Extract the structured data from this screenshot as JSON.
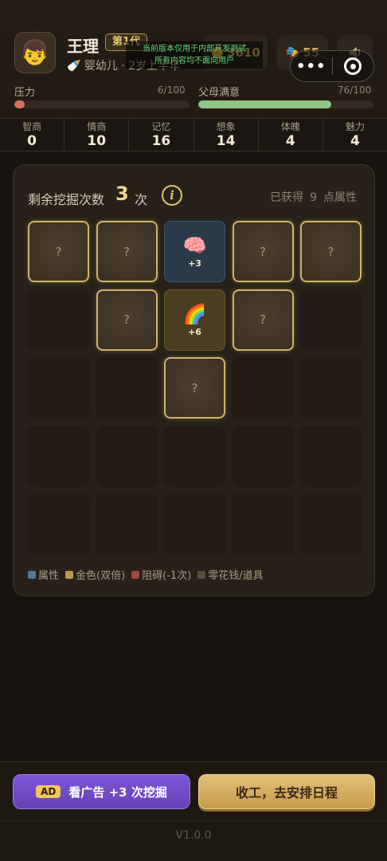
{
  "player": {
    "avatar_icon": "👦",
    "name": "王理",
    "generation": "第1代",
    "stage_icon": "🍼",
    "stage": "婴幼儿 · 2岁上半年"
  },
  "currency": {
    "money": "3610",
    "money_icon": "coin-icon",
    "tokens": "55",
    "tokens_icon": "🎭"
  },
  "dev_notice": {
    "line1": "当前版本仅用于内部开发测试",
    "line2": "所有内容均不面向用户"
  },
  "capsule": {
    "more": "•••"
  },
  "bars": {
    "pressure": {
      "label": "压力",
      "value": "6/100",
      "fraction": 0.06,
      "color": "#d8705a"
    },
    "parent": {
      "label": "父母满意",
      "value": "76/100",
      "fraction": 0.76,
      "color": "#8fc78a"
    }
  },
  "stats": [
    {
      "label": "智商",
      "value": "0"
    },
    {
      "label": "情商",
      "value": "10"
    },
    {
      "label": "记忆",
      "value": "16"
    },
    {
      "label": "想象",
      "value": "14"
    },
    {
      "label": "体魄",
      "value": "4"
    },
    {
      "label": "魅力",
      "value": "4"
    }
  ],
  "dig": {
    "remaining_label": "剩余挖掘次数",
    "remaining": "3",
    "remaining_unit": "次",
    "info_icon": "i",
    "gained_prefix": "已获得",
    "gained_value": "9",
    "gained_suffix": "点属性"
  },
  "grid": {
    "cols": 5,
    "rows": 5,
    "cells": [
      {
        "r": 0,
        "c": 0,
        "state": "hidden",
        "text": "?"
      },
      {
        "r": 0,
        "c": 1,
        "state": "hidden",
        "text": "?"
      },
      {
        "r": 0,
        "c": 2,
        "state": "attr",
        "emoji": "🧠",
        "gain": "+3"
      },
      {
        "r": 0,
        "c": 3,
        "state": "hidden",
        "text": "?"
      },
      {
        "r": 0,
        "c": 4,
        "state": "hidden",
        "text": "?"
      },
      {
        "r": 1,
        "c": 1,
        "state": "hidden",
        "text": "?"
      },
      {
        "r": 1,
        "c": 2,
        "state": "gold",
        "emoji": "🌈",
        "gain": "+6"
      },
      {
        "r": 1,
        "c": 3,
        "state": "hidden",
        "text": "?"
      },
      {
        "r": 2,
        "c": 2,
        "state": "hidden",
        "text": "?"
      }
    ]
  },
  "legend": [
    {
      "label": "属性",
      "color": "#4f7a96"
    },
    {
      "label": "金色(双倍)",
      "color": "#b89a4a"
    },
    {
      "label": "阻碍(-1次)",
      "color": "#a14b3a"
    },
    {
      "label": "零花钱/道具",
      "color": "#5a4c3a"
    }
  ],
  "buttons": {
    "ad_badge": "AD",
    "ad_label": "看广告 +3 次挖掘",
    "finish_label": "收工，去安排日程"
  },
  "version": "V1.0.0"
}
